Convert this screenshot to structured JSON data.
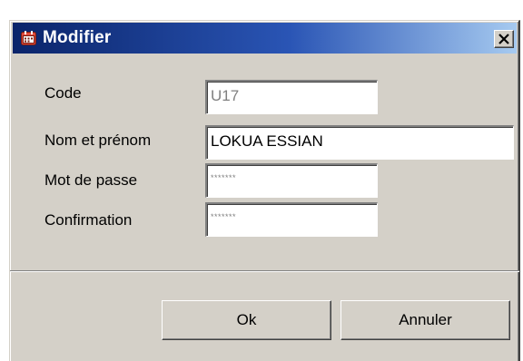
{
  "window": {
    "title": "Modifier",
    "close_label": "close"
  },
  "form": {
    "code": {
      "label": "Code",
      "value": "U17",
      "enabled": false
    },
    "name": {
      "label": "Nom et prénom",
      "value": "LOKUA ESSIAN"
    },
    "password": {
      "label": "Mot de passe",
      "value": "*******"
    },
    "confirmation": {
      "label": "Confirmation",
      "value": "*******"
    }
  },
  "buttons": {
    "ok_label": "Ok",
    "cancel_label": "Annuler"
  },
  "colors": {
    "titlebar_start": "#0a246a",
    "titlebar_end": "#a6caf0",
    "face": "#d4d0c8"
  },
  "icons": {
    "app": "calendar-icon",
    "close": "close-icon"
  }
}
